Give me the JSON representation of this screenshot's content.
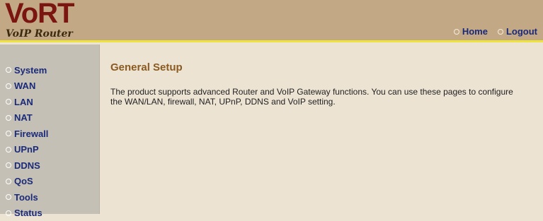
{
  "header": {
    "logo_main": "VoRT",
    "logo_sub": "VoIP Router",
    "nav": [
      {
        "label": "Home"
      },
      {
        "label": "Logout"
      }
    ]
  },
  "sidebar": {
    "items": [
      {
        "label": "System"
      },
      {
        "label": "WAN"
      },
      {
        "label": "LAN"
      },
      {
        "label": "NAT"
      },
      {
        "label": "Firewall"
      },
      {
        "label": "UPnP"
      },
      {
        "label": "DDNS"
      },
      {
        "label": "QoS"
      },
      {
        "label": "Tools"
      },
      {
        "label": "Status"
      }
    ]
  },
  "main": {
    "title": "General Setup",
    "description": "The product supports advanced Router and VoIP Gateway functions. You can use these pages to configure the WAN/LAN, firewall, NAT, UPnP, DDNS and VoIP setting."
  },
  "colors": {
    "header_bg": "#c3a886",
    "header_rule": "#ece33d",
    "sidebar_bg": "#c5c0b5",
    "content_bg": "#ece3d3",
    "link": "#1a2a7a",
    "title": "#8a5a20",
    "logo": "#7a1510"
  },
  "icons": {
    "nav_bullet": "circle-bullet-icon"
  }
}
